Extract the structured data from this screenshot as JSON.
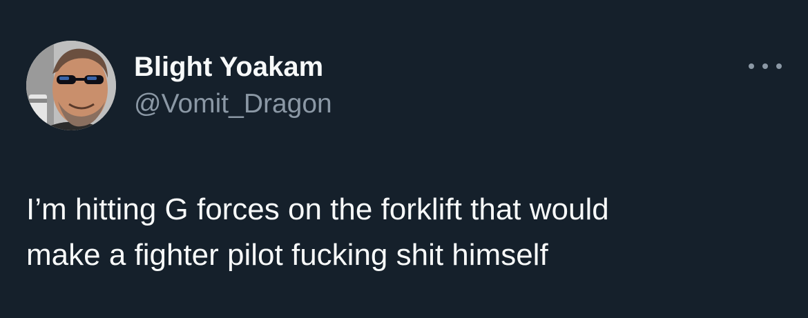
{
  "colors": {
    "background": "#15202b",
    "primary_text": "#f7f9f9",
    "secondary_text": "#8b98a5"
  },
  "author": {
    "display_name": "Blight Yoakam",
    "handle": "@Vomit_Dragon",
    "avatar_description_icon": "profile-photo-man-sunglasses"
  },
  "menu": {
    "icon": "more-horizontal-icon"
  },
  "tweet": {
    "line1": "I’m hitting G forces on the forklift that would",
    "line2": "make a fighter pilot fucking shit himself"
  }
}
